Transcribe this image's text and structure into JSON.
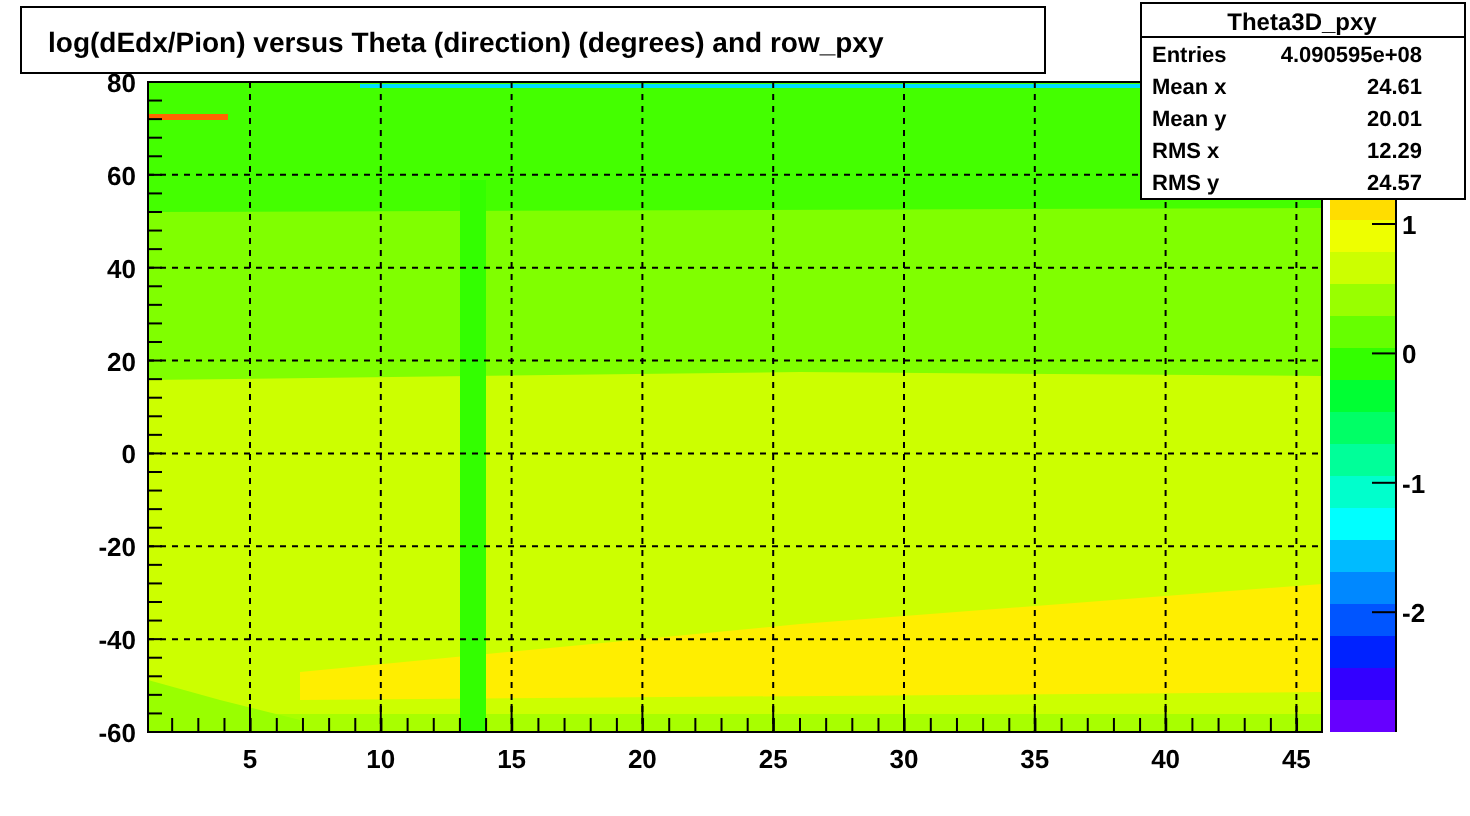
{
  "title": "log(dEdx/Pion) versus Theta (direction) (degrees) and row_pxy",
  "stats": {
    "name": "Theta3D_pxy",
    "rows": [
      {
        "label": "Entries",
        "value": "4.090595e+08"
      },
      {
        "label": "Mean x",
        "value": "24.61"
      },
      {
        "label": "Mean y",
        "value": "20.01"
      },
      {
        "label": "RMS x",
        "value": "12.29"
      },
      {
        "label": "RMS y",
        "value": "24.57"
      }
    ]
  },
  "x_axis": {
    "tick_labels": [
      "5",
      "10",
      "15",
      "20",
      "25",
      "30",
      "35",
      "40",
      "45"
    ]
  },
  "y_axis": {
    "tick_labels": [
      "80",
      "60",
      "40",
      "20",
      "0",
      "-20",
      "-40",
      "-60"
    ]
  },
  "palette": {
    "tick_labels": [
      "1",
      "0",
      "-1",
      "-2"
    ]
  }
}
